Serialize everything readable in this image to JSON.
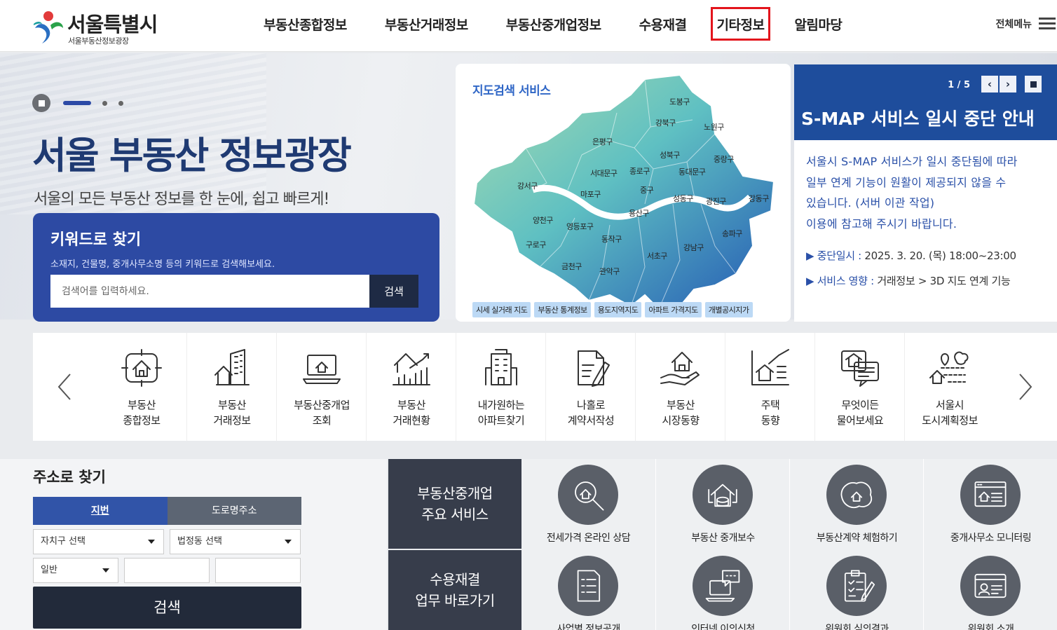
{
  "header": {
    "logo_title": "서울특별시",
    "logo_sub": "서울부동산정보광장",
    "nav": [
      {
        "label": "부동산종합정보"
      },
      {
        "label": "부동산거래정보"
      },
      {
        "label": "부동산중개업정보"
      },
      {
        "label": "수용재결"
      },
      {
        "label": "기타정보",
        "active": true
      },
      {
        "label": "알림마당"
      }
    ],
    "all_menu_label": "전체메뉴"
  },
  "hero": {
    "title": "서울 부동산 정보광장",
    "subtitle": "서울의 모든 부동산 정보를 한 눈에, 쉽고 빠르게!",
    "keyword": {
      "title": "키워드로 찾기",
      "desc": "소재지, 건물명, 중개사무소명 등의 키워드로 검색해보세요.",
      "placeholder": "검색어를 입력하세요.",
      "button": "검색"
    }
  },
  "map": {
    "title": "지도검색 서비스",
    "districts": [
      "도봉구",
      "강북구",
      "노원구",
      "은평구",
      "성북구",
      "중랑구",
      "서대문구",
      "종로구",
      "동대문구",
      "강서구",
      "마포구",
      "중구",
      "성동구",
      "광진구",
      "강동구",
      "용산구",
      "양천구",
      "영등포구",
      "동작구",
      "송파구",
      "구로구",
      "강남구",
      "서초구",
      "금천구",
      "관악구"
    ],
    "tags": [
      "시세 실거래 지도",
      "부동산 통계정보",
      "용도지역지도",
      "아파트 가격지도",
      "개별공시지가"
    ]
  },
  "notice": {
    "page": "1 / 5",
    "title": "S-MAP 서비스 일시 중단 안내",
    "body_lines": [
      "서울시 S-MAP 서비스가 일시 중단됨에 따라",
      "일부 연계 기능이 원활이 제공되지 않을 수",
      "있습니다. (서버 이관 작업)",
      "이용에 참고해 주시기 바랍니다."
    ],
    "date_key": "▶ 중단일시 :",
    "date_val": " 2025. 3. 20. (목) 18:00~23:00",
    "effect_key": "▶ 서비스 영향 :",
    "effect_val": " 거래정보 > 3D 지도 연계 기능"
  },
  "shortcuts": [
    {
      "l1": "부동산",
      "l2": "종합정보",
      "icon": "house-target-icon"
    },
    {
      "l1": "부동산",
      "l2": "거래정보",
      "icon": "buildings-icon"
    },
    {
      "l1": "부동산중개업",
      "l2": "조회",
      "icon": "laptop-house-icon"
    },
    {
      "l1": "부동산",
      "l2": "거래현황",
      "icon": "chart-house-icon"
    },
    {
      "l1": "내가원하는",
      "l2": "아파트찾기",
      "icon": "apartment-icon"
    },
    {
      "l1": "나홀로",
      "l2": "계약서작성",
      "icon": "contract-pen-icon"
    },
    {
      "l1": "부동산",
      "l2": "시장동향",
      "icon": "hand-house-icon"
    },
    {
      "l1": "주택",
      "l2": "동향",
      "icon": "house-trend-icon"
    },
    {
      "l1": "무엇이든",
      "l2": "물어보세요",
      "icon": "chat-house-icon"
    },
    {
      "l1": "서울시",
      "l2": "도시계획정보",
      "icon": "city-plan-icon"
    }
  ],
  "address": {
    "title": "주소로 찾기",
    "tabs": [
      "지번",
      "도로명주소"
    ],
    "district_select": "자치구 선택",
    "dong_select": "법정동 선택",
    "type_select": "일반",
    "button": "검색"
  },
  "services": [
    {
      "label_line1": "부동산중개업",
      "label_line2": "주요 서비스",
      "items": [
        {
          "label": "전세가격 온라인 상담",
          "icon": "house-search-icon"
        },
        {
          "label": "부동산 중개보수",
          "icon": "house-coins-icon"
        },
        {
          "label": "부동산계약 체험하기",
          "icon": "map-house-icon"
        },
        {
          "label": "중개사무소 모니터링",
          "icon": "browser-house-icon"
        }
      ]
    },
    {
      "label_line1": "수용재결",
      "label_line2": "업무 바로가기",
      "items": [
        {
          "label": "사업별 정보공개",
          "icon": "document-list-icon"
        },
        {
          "label": "인터넷 이의신청",
          "icon": "laptop-chat-icon"
        },
        {
          "label": "위원회 심의결과",
          "icon": "clipboard-check-icon"
        },
        {
          "label": "위원회 소개",
          "icon": "id-card-icon"
        }
      ]
    }
  ],
  "colors": {
    "brand_blue": "#2d4aa3",
    "notice_blue": "#1e4d9c",
    "active_border": "#e3141c",
    "dark_navy": "#222a3a"
  }
}
